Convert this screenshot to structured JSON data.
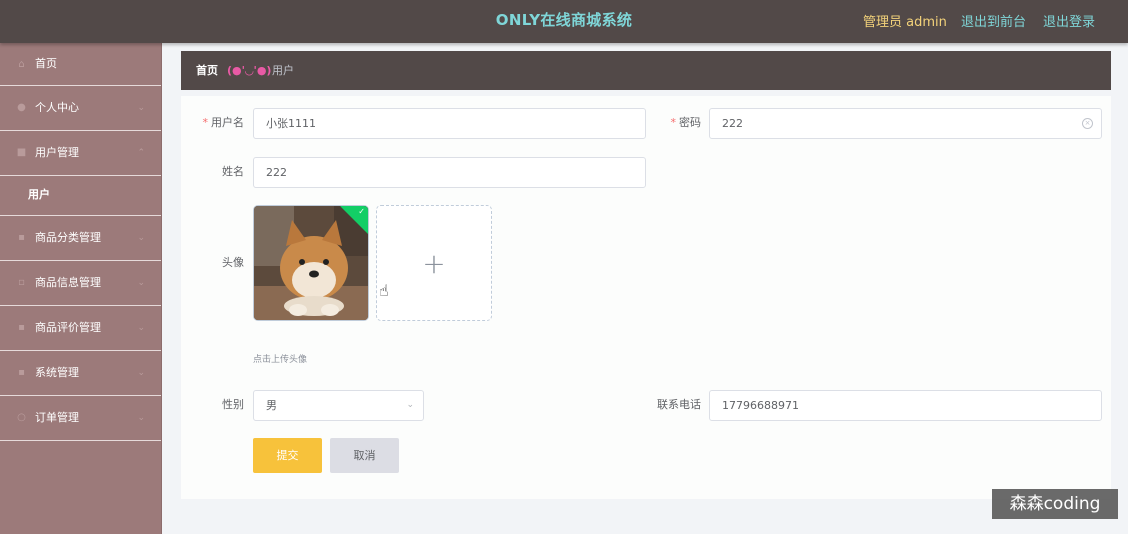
{
  "header": {
    "title": "ONLY在线商城系统",
    "admin_label": "管理员 admin",
    "to_frontend": "退出到前台",
    "logout": "退出登录"
  },
  "sidebar": {
    "items": [
      {
        "label": "首页",
        "icon": "home-icon"
      },
      {
        "label": "个人中心",
        "icon": "user-icon"
      },
      {
        "label": "用户管理",
        "icon": "grid-icon"
      },
      {
        "label": "商品分类管理",
        "icon": "clipboard-icon"
      },
      {
        "label": "商品信息管理",
        "icon": "message-icon"
      },
      {
        "label": "商品评价管理",
        "icon": "briefcase-icon"
      },
      {
        "label": "系统管理",
        "icon": "document-icon"
      },
      {
        "label": "订单管理",
        "icon": "refresh-icon"
      }
    ],
    "subitem": "用户"
  },
  "breadcrumb": {
    "home": "首页",
    "face": "(●'◡'●)",
    "current": "用户"
  },
  "form": {
    "username_label": "用户名",
    "username_value": "小张1111",
    "password_label": "密码",
    "password_value": "222",
    "name_label": "姓名",
    "name_value": "222",
    "avatar_label": "头像",
    "upload_plus": "+",
    "upload_hint": "点击上传头像",
    "gender_label": "性别",
    "gender_value": "男",
    "phone_label": "联系电话",
    "phone_value": "17796688971",
    "submit": "提交",
    "cancel": "取消"
  },
  "watermark": "森森coding"
}
